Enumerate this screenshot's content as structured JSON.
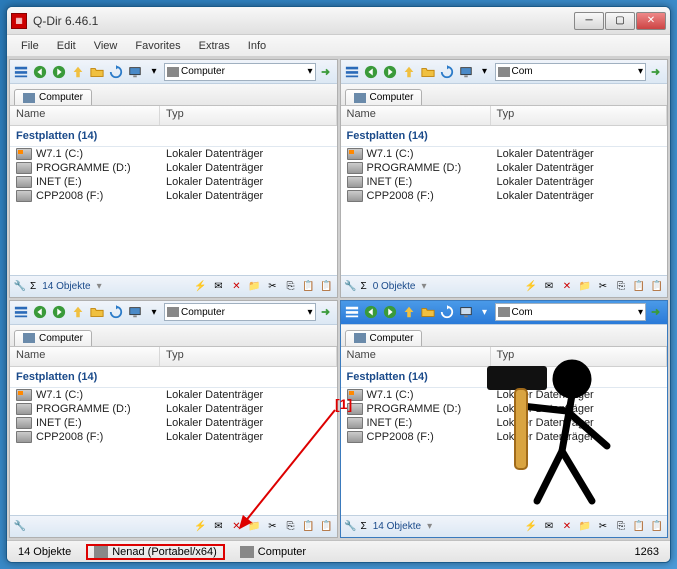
{
  "window": {
    "title": "Q-Dir 6.46.1"
  },
  "menu": {
    "file": "File",
    "edit": "Edit",
    "view": "View",
    "favorites": "Favorites",
    "extras": "Extras",
    "info": "Info"
  },
  "addressbar_text": "Com",
  "addressbar_text_full": "Computer",
  "tab": {
    "label": "Computer"
  },
  "columns": {
    "name": "Name",
    "typ": "Typ"
  },
  "group": {
    "label": "Festplatten (14)"
  },
  "drives": [
    {
      "name": "W7.1 (C:)",
      "typ": "Lokaler Datenträger",
      "kind": "win"
    },
    {
      "name": "PROGRAMME (D:)",
      "typ": "Lokaler Datenträger",
      "kind": "drive"
    },
    {
      "name": "INET (E:)",
      "typ": "Lokaler Datenträger",
      "kind": "drive"
    },
    {
      "name": "CPP2008 (F:)",
      "typ": "Lokaler Datenträger",
      "kind": "drive"
    }
  ],
  "pane_footer": {
    "sigma": "Σ",
    "count14": "14 Objekte",
    "count0": "0 Objekte"
  },
  "statusbar": {
    "objects": "14 Objekte",
    "user": "Nenad (Portabel/x64)",
    "location": "Computer",
    "number": "1263"
  },
  "annotation": {
    "label": "[1]"
  },
  "icons": {
    "view_list": "view-list-icon",
    "back": "back-icon",
    "forward": "forward-icon",
    "up": "up-icon",
    "folder": "folder-icon",
    "refresh": "refresh-icon",
    "monitor": "monitor-icon",
    "dropdown": "dropdown-icon",
    "bolt": "bolt-icon",
    "mail": "mail-icon",
    "delete": "delete-icon",
    "folder2": "folder-icon",
    "cut": "cut-icon",
    "copy": "copy-icon",
    "paste": "paste-icon",
    "wrench": "wrench-icon"
  },
  "colors": {
    "annotation": "#d00",
    "active_pane": "#3a7abd"
  }
}
